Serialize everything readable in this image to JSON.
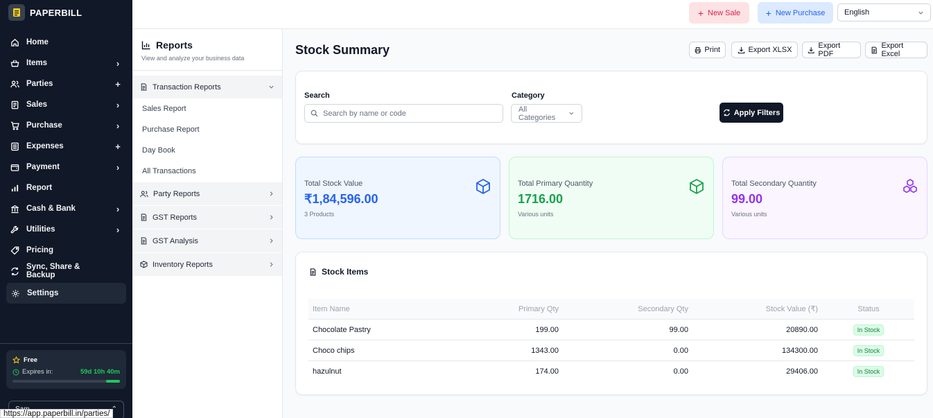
{
  "app": {
    "name": "PAPERBILL"
  },
  "sidebar": {
    "items": [
      {
        "label": "Home",
        "icon": "home-icon",
        "trail": ""
      },
      {
        "label": "Items",
        "icon": "basket-icon",
        "trail": "›"
      },
      {
        "label": "Parties",
        "icon": "users-icon",
        "trail": "+"
      },
      {
        "label": "Sales",
        "icon": "receipt-icon",
        "trail": "›"
      },
      {
        "label": "Purchase",
        "icon": "cart-icon",
        "trail": "›"
      },
      {
        "label": "Expenses",
        "icon": "expense-icon",
        "trail": "+"
      },
      {
        "label": "Payment",
        "icon": "wallet-icon",
        "trail": "›"
      },
      {
        "label": "Report",
        "icon": "bar-chart-icon",
        "trail": ""
      },
      {
        "label": "Cash & Bank",
        "icon": "bank-icon",
        "trail": "›"
      },
      {
        "label": "Utilities",
        "icon": "wrench-icon",
        "trail": "›"
      },
      {
        "label": "Pricing",
        "icon": "tag-icon",
        "trail": ""
      },
      {
        "label": "Sync, Share & Backup",
        "icon": "sync-icon",
        "trail": ""
      },
      {
        "label": "Settings",
        "icon": "gear-icon",
        "trail": ""
      }
    ],
    "plan": {
      "name": "Free",
      "expires_label": "Expires in:",
      "expires_value": "59d 10h 40m",
      "remaining_fraction": 0.13
    },
    "company": {
      "name": "Sam...",
      "chevron": "⌃"
    }
  },
  "statusbar": {
    "url": "https://app.paperbill.in/parties/"
  },
  "topbar": {
    "new_sale": "New Sale",
    "new_purchase": "New Purchase",
    "language": "English"
  },
  "reports_panel": {
    "title": "Reports",
    "subtitle": "View and analyze your business data",
    "sections": [
      {
        "label": "Transaction Reports",
        "expanded": true,
        "icon": "document-icon"
      },
      {
        "label": "Party Reports",
        "expanded": false,
        "icon": "users-icon"
      },
      {
        "label": "GST Reports",
        "expanded": false,
        "icon": "document-icon"
      },
      {
        "label": "GST Analysis",
        "expanded": false,
        "icon": "document-icon"
      },
      {
        "label": "Inventory Reports",
        "expanded": false,
        "icon": "box-icon"
      }
    ],
    "transaction_items": [
      "Sales Report",
      "Purchase Report",
      "Day Book",
      "All Transactions"
    ]
  },
  "main": {
    "title": "Stock Summary",
    "actions": {
      "print": "Print",
      "export_xlsx": "Export XLSX",
      "export_pdf": "Export PDF",
      "export_excel": "Export Excel"
    },
    "filters": {
      "search_label": "Search",
      "search_placeholder": "Search by name or code",
      "category_label": "Category",
      "category_value": "All Categories",
      "apply": "Apply Filters"
    },
    "stats": [
      {
        "label": "Total Stock Value",
        "value": "₹1,84,596.00",
        "sub": "3 Products",
        "color": "#2563eb",
        "bg": "#eff6ff",
        "border": "#bfdbfe"
      },
      {
        "label": "Total Primary Quantity",
        "value": "1716.00",
        "sub": "Various units",
        "color": "#16a34a",
        "bg": "#f0fdf4",
        "border": "#bbf7d0"
      },
      {
        "label": "Total Secondary Quantity",
        "value": "99.00",
        "sub": "Various units",
        "color": "#9333ea",
        "bg": "#faf5ff",
        "border": "#e9d5ff"
      }
    ],
    "stock_items": {
      "title": "Stock Items",
      "columns": [
        "Item Name",
        "Primary Qty",
        "Secondary Qty",
        "Stock Value (₹)",
        "Status"
      ],
      "rows": [
        {
          "name": "Chocolate Pastry",
          "primary": "199.00",
          "secondary": "99.00",
          "value": "20890.00",
          "status": "In Stock"
        },
        {
          "name": "Choco chips",
          "primary": "1343.00",
          "secondary": "0.00",
          "value": "134300.00",
          "status": "In Stock"
        },
        {
          "name": "hazulnut",
          "primary": "174.00",
          "secondary": "0.00",
          "value": "29406.00",
          "status": "In Stock"
        }
      ]
    }
  }
}
